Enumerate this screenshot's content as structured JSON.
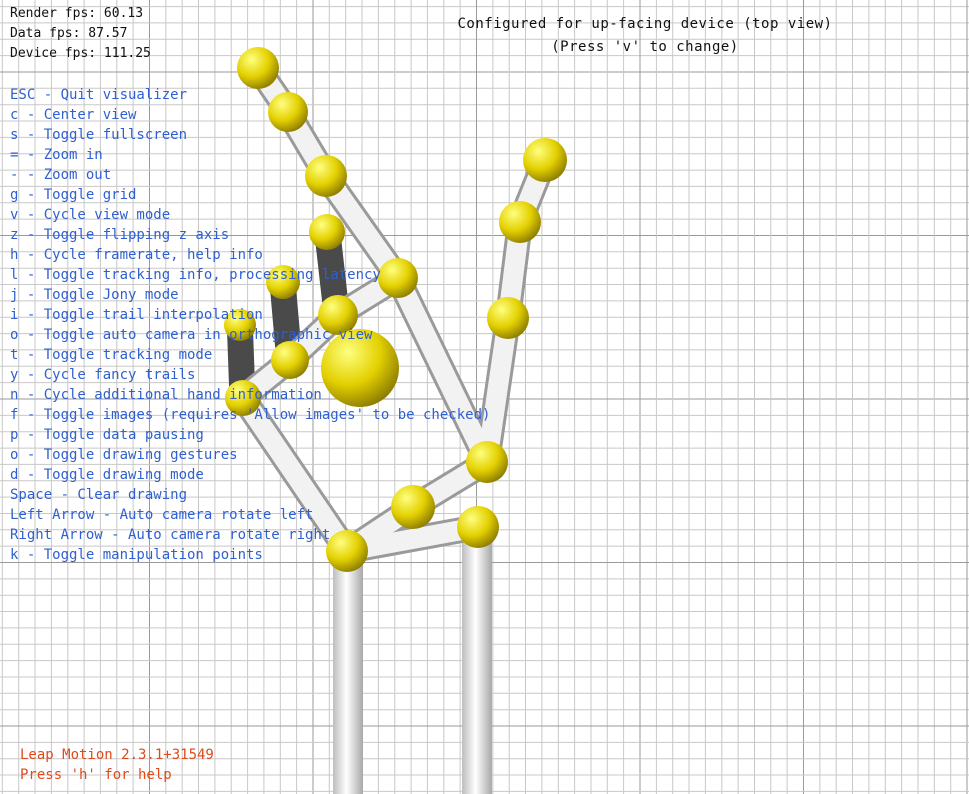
{
  "stats": {
    "render_fps": "Render fps: 60.13",
    "data_fps": "Data fps: 87.57",
    "device_fps": "Device fps: 111.25"
  },
  "config": {
    "line1": "Configured for up-facing device (top view)",
    "line2": "(Press 'v' to change)"
  },
  "help_items": [
    "ESC - Quit visualizer",
    "c - Center view",
    "s - Toggle fullscreen",
    "= - Zoom in",
    "- - Zoom out",
    "g - Toggle grid",
    "v - Cycle view mode",
    "z - Toggle flipping z axis",
    "h - Cycle framerate, help info",
    "l - Toggle tracking info, processing latency",
    "j - Toggle Jony mode",
    "i - Toggle trail interpolation",
    "o - Toggle auto camera in orthographic view",
    "t - Toggle tracking mode",
    "y - Cycle fancy trails",
    "n - Cycle additional hand information",
    "f - Toggle images (requires 'Allow images' to be checked)",
    "p - Toggle data pausing",
    "o - Toggle drawing gestures",
    "d - Toggle drawing mode",
    "Space - Clear drawing",
    "Left Arrow - Auto camera rotate left",
    "Right Arrow - Auto camera rotate right",
    "k - Toggle manipulation points"
  ],
  "footer": {
    "version": "Leap Motion 2.3.1+31549",
    "help_hint": "Press 'h' for help"
  },
  "colors": {
    "grid_minor": "#c8c8c8",
    "grid_major": "#9a9a9a",
    "joint": "#e3d000",
    "bone": "#ececec",
    "occluded_bone": "#4a4a4a",
    "help_text": "#2f5fd0",
    "version_text": "#e04a1a"
  }
}
